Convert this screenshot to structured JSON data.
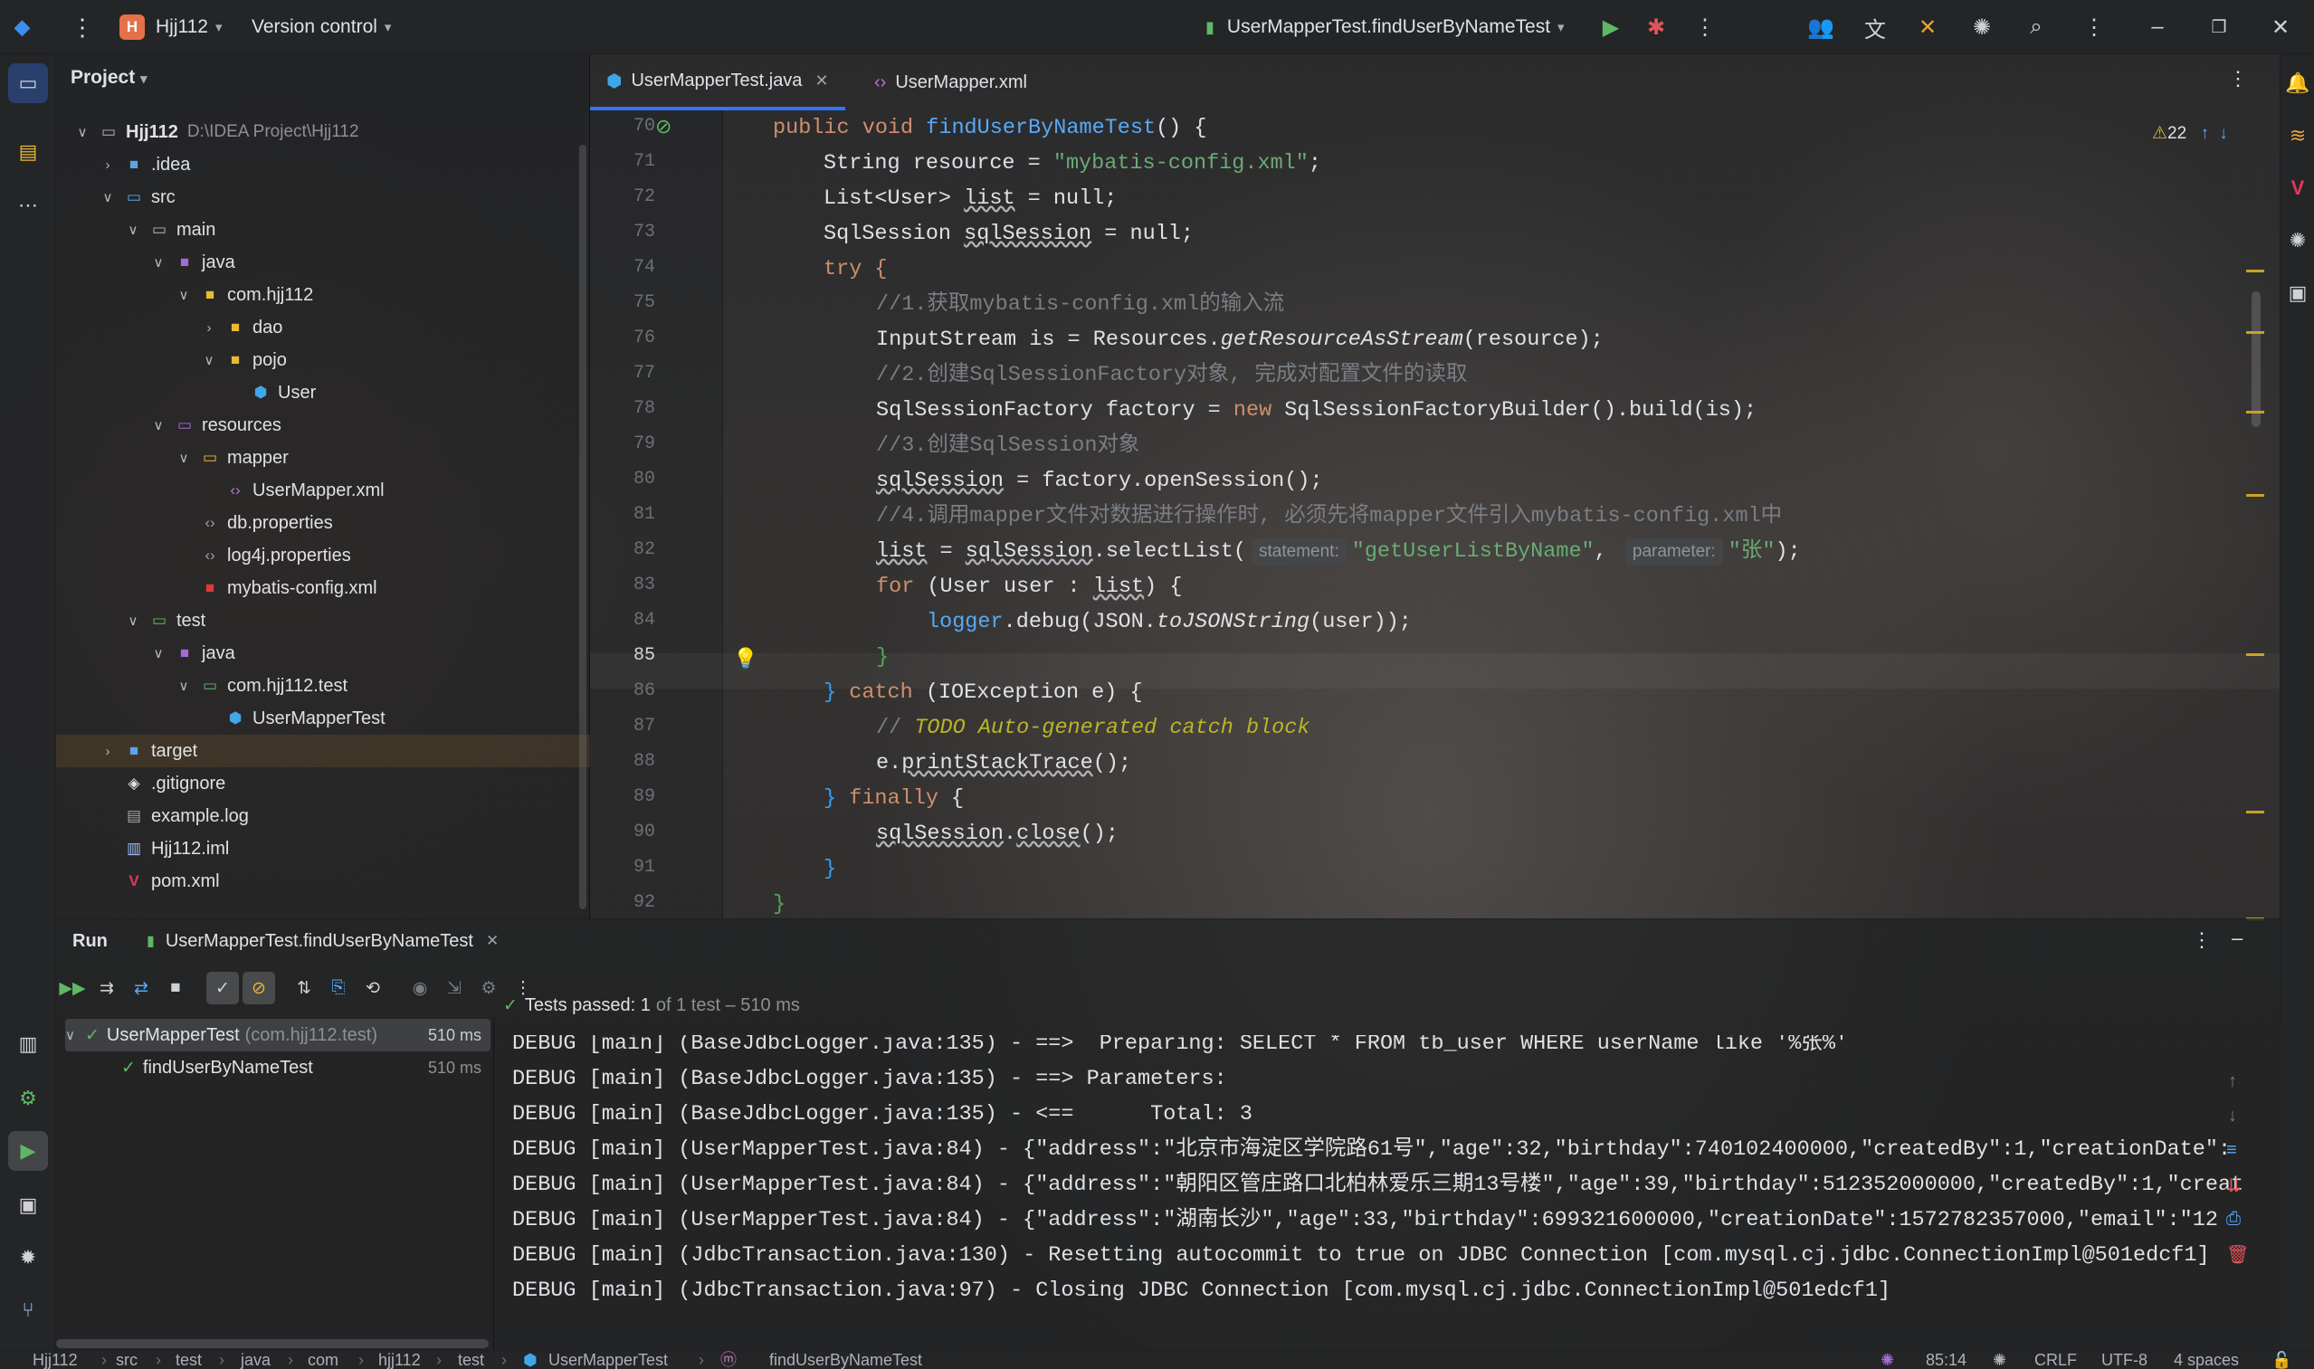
{
  "titlebar": {
    "project_badge": "H",
    "project_name": "Hjj112",
    "vcs_label": "Version control",
    "run_config": "UserMapperTest.findUserByNameTest"
  },
  "sidebar": {
    "project_label": "Project"
  },
  "tree": [
    {
      "label": "Hjj112",
      "path": "D:\\IDEA Project\\Hjj112"
    },
    {
      "label": ".idea"
    },
    {
      "label": "src"
    },
    {
      "label": "main"
    },
    {
      "label": "java"
    },
    {
      "label": "com.hjj112"
    },
    {
      "label": "dao"
    },
    {
      "label": "pojo"
    },
    {
      "label": "User"
    },
    {
      "label": "resources"
    },
    {
      "label": "mapper"
    },
    {
      "label": "UserMapper.xml"
    },
    {
      "label": "db.properties"
    },
    {
      "label": "log4j.properties"
    },
    {
      "label": "mybatis-config.xml"
    },
    {
      "label": "test"
    },
    {
      "label": "java"
    },
    {
      "label": "com.hjj112.test"
    },
    {
      "label": "UserMapperTest"
    },
    {
      "label": "target"
    },
    {
      "label": ".gitignore"
    },
    {
      "label": "example.log"
    },
    {
      "label": "Hjj112.iml"
    },
    {
      "label": "pom.xml"
    }
  ],
  "tabs": [
    {
      "label": "UserMapperTest.java"
    },
    {
      "label": "UserMapper.xml"
    }
  ],
  "editor": {
    "warnings": "22",
    "line_numbers": [
      "70",
      "71",
      "72",
      "73",
      "74",
      "75",
      "76",
      "77",
      "78",
      "79",
      "80",
      "81",
      "82",
      "83",
      "84",
      "85",
      "86",
      "87",
      "88",
      "89",
      "90",
      "91",
      "92"
    ],
    "lines": {
      "l70a": "public void ",
      "l70b": "findUserByNameTest",
      "l70c": "() {",
      "l71a": "String resource = ",
      "l71b": "\"mybatis-config.xml\"",
      "l71c": ";",
      "l72a": "List<User> ",
      "l72b": "list",
      "l72c": " = null;",
      "l73a": "SqlSession ",
      "l73b": "sqlSession",
      "l73c": " = null;",
      "l74": "try {",
      "l75": "//1.获取mybatis-config.xml的输入流",
      "l76a": "InputStream is = Resources.",
      "l76b": "getResourceAsStream",
      "l76c": "(resource);",
      "l77": "//2.创建SqlSessionFactory对象, 完成对配置文件的读取",
      "l78a": "SqlSessionFactory factory = ",
      "l78b": "new",
      "l78c": " SqlSessionFactoryBuilder().build(is);",
      "l79": "//3.创建SqlSession对象",
      "l80a": "sqlSession",
      "l80b": " = factory.openSession();",
      "l81": "//4.调用mapper文件对数据进行操作时, 必须先将mapper文件引入mybatis-config.xml中",
      "l82a": "list",
      "l82b": " = ",
      "l82c": "sqlSession",
      "l82d": ".selectList(",
      "l82hint1": "statement:",
      "l82e": "\"getUserListByName\"",
      ",l82f": ", ",
      "l82hint2": "parameter:",
      "l82g": "\"张\"",
      "l82h": ");",
      "l83a": "for",
      "l83b": " (User user : ",
      "l83c": "list",
      "l83d": ") {",
      "l84a": "logger",
      "l84b": ".debug(JSON.",
      "l84c": "toJSONString",
      "l84d": "(user));",
      "l85": "}",
      "l86a": "} ",
      "l86b": "catch",
      "l86c": " (IOException e) {",
      "l87a": "// ",
      "l87b": "TODO Auto-generated catch block",
      "l88a": "e.",
      "l88b": "printStackTrace",
      "l88c": "();",
      "l89a": "} ",
      "l89b": "finally",
      "l89c": " {",
      "l90a": "sqlSession",
      ".l90b": ".",
      "l90c": "close",
      "l90d": "();",
      "l91": "}",
      "l92": "}"
    }
  },
  "run": {
    "label": "Run",
    "tab": "UserMapperTest.findUserByNameTest",
    "tests": [
      {
        "name": "UserMapperTest",
        "pkg": "(com.hjj112.test)",
        "time": "510 ms"
      },
      {
        "name": "findUserByNameTest",
        "time": "510 ms"
      }
    ],
    "summary_passed": "Tests passed: 1",
    "summary_rest": "of 1 test – 510 ms",
    "output": [
      "DEBUG [main] (BaseJdbcLogger.java:135) - ==>  Preparing: SELECT * FROM tb_user WHERE userName like '%张%'",
      "DEBUG [main] (BaseJdbcLogger.java:135) - ==> Parameters: ",
      "DEBUG [main] (BaseJdbcLogger.java:135) - <==      Total: 3",
      "DEBUG [main] (UserMapperTest.java:84) - {\"address\":\"北京市海淀区学院路61号\",\"age\":32,\"birthday\":740102400000,\"createdBy\":1,\"creationDate\":",
      "DEBUG [main] (UserMapperTest.java:84) - {\"address\":\"朝阳区管庄路口北柏林爱乐三期13号楼\",\"age\":39,\"birthday\":512352000000,\"createdBy\":1,\"creat",
      "DEBUG [main] (UserMapperTest.java:84) - {\"address\":\"湖南长沙\",\"age\":33,\"birthday\":699321600000,\"creationDate\":1572782357000,\"email\":\"12",
      "DEBUG [main] (JdbcTransaction.java:130) - Resetting autocommit to true on JDBC Connection [com.mysql.cj.jdbc.ConnectionImpl@501edcf1]",
      "DEBUG [main] (JdbcTransaction.java:97) - Closing JDBC Connection [com.mysql.cj.jdbc.ConnectionImpl@501edcf1]"
    ]
  },
  "statusbar": {
    "breadcrumb": [
      "Hjj112",
      "src",
      "test",
      "java",
      "com",
      "hjj112",
      "test",
      "UserMapperTest",
      "findUserByNameTest"
    ],
    "position": "85:14",
    "line_sep": "CRLF",
    "encoding": "UTF-8",
    "indent": "4 spaces"
  }
}
